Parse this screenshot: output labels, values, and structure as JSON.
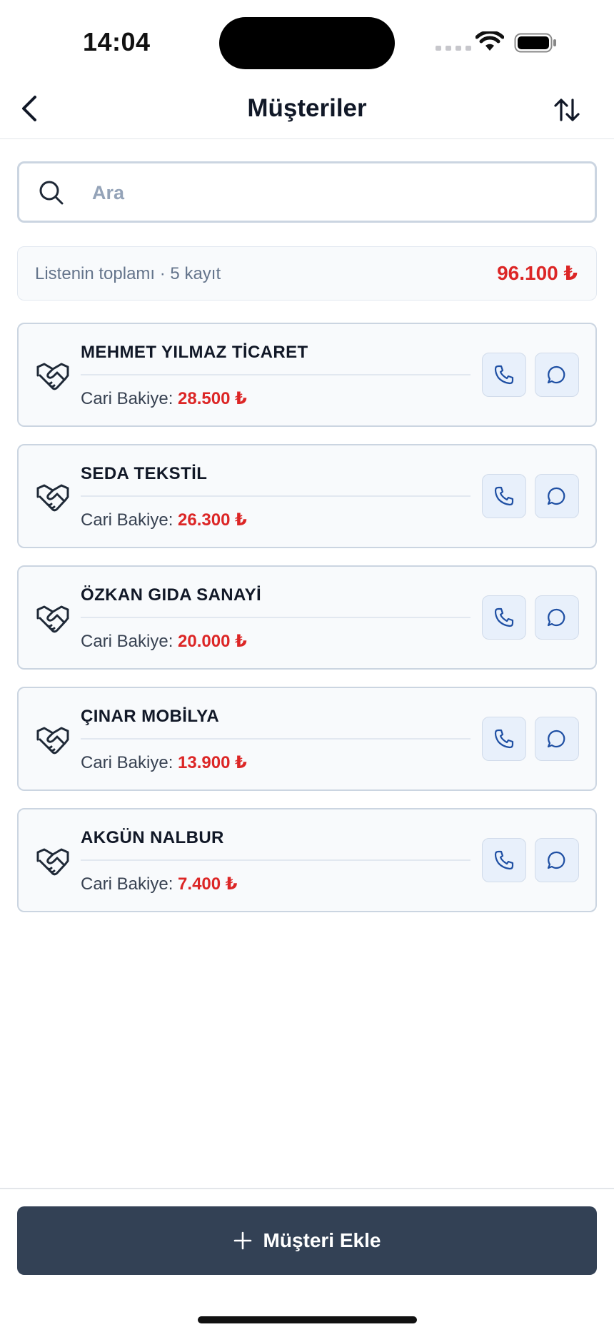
{
  "status_bar": {
    "time": "14:04"
  },
  "header": {
    "title": "Müşteriler",
    "back_icon": "chevron-left-icon",
    "sort_icon": "sort-arrows-icon"
  },
  "search": {
    "placeholder": "Ara",
    "value": ""
  },
  "summary": {
    "label": "Listenin toplamı · 5 kayıt",
    "total": "96.100 ₺"
  },
  "customers": [
    {
      "name": "MEHMET YILMAZ TİCARET",
      "balance_label": "Cari Bakiye:",
      "balance": "28.500 ₺"
    },
    {
      "name": "SEDA TEKSTİL",
      "balance_label": "Cari Bakiye:",
      "balance": "26.300 ₺"
    },
    {
      "name": "ÖZKAN GIDA SANAYİ",
      "balance_label": "Cari Bakiye:",
      "balance": "20.000 ₺"
    },
    {
      "name": "ÇINAR MOBİLYA",
      "balance_label": "Cari Bakiye:",
      "balance": "13.900 ₺"
    },
    {
      "name": "AKGÜN NALBUR",
      "balance_label": "Cari Bakiye:",
      "balance": "7.400 ₺"
    }
  ],
  "footer": {
    "add_button_label": "Müşteri Ekle"
  },
  "colors": {
    "accent_dark": "#334155",
    "balance_red": "#dc2626",
    "icon_blue": "#1e4fa3"
  }
}
